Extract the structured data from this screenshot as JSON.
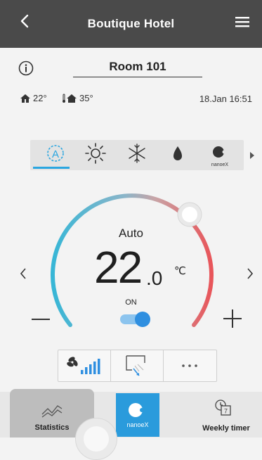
{
  "header": {
    "title": "Boutique Hotel",
    "back_icon": "chevron-left-icon",
    "menu_icon": "hamburger-menu-icon"
  },
  "room": {
    "name": "Room 101",
    "info_icon": "info-icon"
  },
  "status": {
    "indoor_temp": "22°",
    "outdoor_temp": "35°",
    "datetime": "18.Jan 16:51"
  },
  "modes": {
    "items": [
      "auto-icon",
      "sun-icon",
      "snowflake-icon",
      "drop-icon",
      "nanoe-x-icon"
    ],
    "selected_index": 0,
    "nanoe_label": "nanoeX"
  },
  "thermostat": {
    "mode": "Auto",
    "temp_integer": "22",
    "temp_decimal": ".0",
    "unit": "℃",
    "power_label": "ON",
    "power_on": true,
    "accent_cool": "#37b6d6",
    "accent_warm": "#e8555a"
  },
  "controls": {
    "fan_icon": "fan-speed-icon",
    "airflow_icon": "airflow-direction-icon",
    "more_icon": "more-icon"
  },
  "bottom_nav": {
    "statistics_label": "Statistics",
    "nanoe_label": "nanoeX",
    "weekly_label": "Weekly timer"
  },
  "colors": {
    "topbar": "#4a4a4a",
    "accent_blue": "#2a9bdc",
    "toggle_blue": "#2f8fe0"
  }
}
